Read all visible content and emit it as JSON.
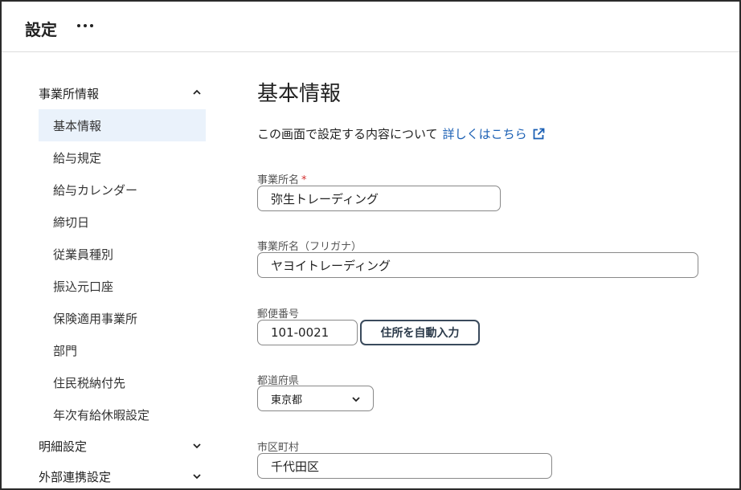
{
  "header": {
    "title": "設定"
  },
  "sidebar": {
    "groups": [
      {
        "label": "事業所情報",
        "expanded": true,
        "items": [
          {
            "label": "基本情報",
            "active": true
          },
          {
            "label": "給与規定"
          },
          {
            "label": "給与カレンダー"
          },
          {
            "label": "締切日"
          },
          {
            "label": "従業員種別"
          },
          {
            "label": "振込元口座"
          },
          {
            "label": "保険適用事業所"
          },
          {
            "label": "部門"
          },
          {
            "label": "住民税納付先"
          },
          {
            "label": "年次有給休暇設定"
          }
        ]
      },
      {
        "label": "明細設定",
        "expanded": false
      },
      {
        "label": "外部連携設定",
        "expanded": false
      }
    ]
  },
  "main": {
    "title": "基本情報",
    "intro_text": "この画面で設定する内容について",
    "intro_link": "詳しくはこちら",
    "fields": {
      "office_name": {
        "label": "事業所名",
        "required_mark": "*",
        "value": "弥生トレーディング"
      },
      "office_name_kana": {
        "label": "事業所名（フリガナ）",
        "value": "ヤヨイトレーディング"
      },
      "postal_code": {
        "label": "郵便番号",
        "value": "101-0021",
        "button": "住所を自動入力"
      },
      "prefecture": {
        "label": "都道府県",
        "value": "東京都"
      },
      "city": {
        "label": "市区町村",
        "value": "千代田区"
      }
    }
  },
  "colors": {
    "accent": "#1a5fb4",
    "active_bg": "#eaf2fb",
    "required": "#d32f2f",
    "border": "#888888"
  }
}
